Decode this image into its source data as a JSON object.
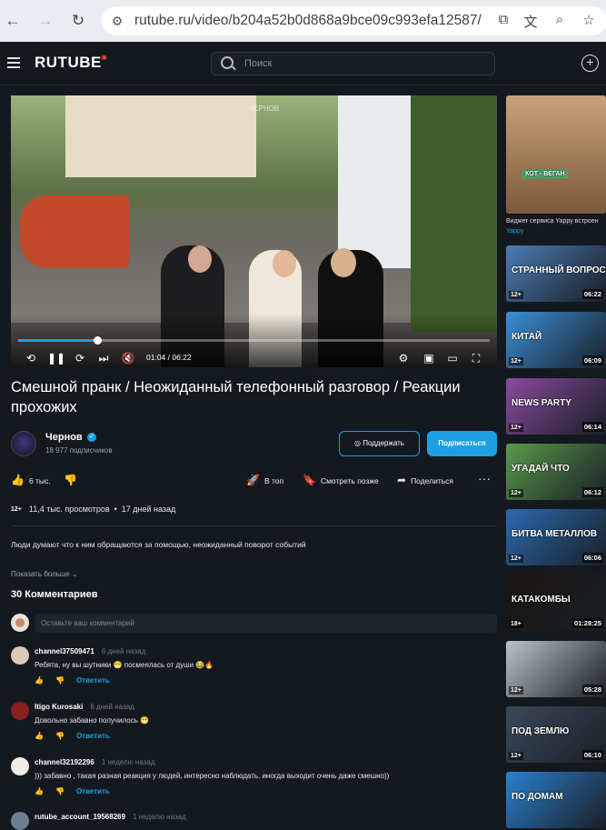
{
  "browser": {
    "url": "rutube.ru/video/b204a52b0d868a9bce09c993efa12587/"
  },
  "header": {
    "logo": "RUTUBE",
    "search_placeholder": "Поиск"
  },
  "player": {
    "watermark": "ЧЕРНОВ",
    "current_time": "01:04",
    "duration": "06:22",
    "time_label": "01:04 / 06:22",
    "progress_fraction": 0.167
  },
  "video": {
    "title": "Смешной пранк / Неожиданный телефонный разговор / Реакции прохожих",
    "channel_name": "Чернов",
    "subscribers": "18 977 подписчиков",
    "support_label": "Поддержать",
    "subscribe_label": "Подписаться",
    "likes": "6 тыс.",
    "top_label": "В топ",
    "watch_later_label": "Смотреть позже",
    "share_label": "Поделиться",
    "age_rating": "12+",
    "views": "11,4 тыс. просмотров",
    "published": "17 дней назад",
    "description": "Люди думают что к ним обращаются за помощью, неожиданный поворот событий",
    "show_more": "Показать больше"
  },
  "comments": {
    "count_label": "30 Комментариев",
    "input_placeholder": "Оставьте ваш комментарий",
    "reply_label": "Ответить",
    "items": [
      {
        "author": "channel37509471",
        "when": "6 дней назад",
        "text": "Ребята, ну вы шутники 😁 посмеялась от души 😂🔥"
      },
      {
        "author": "Itigo Kurosaki",
        "when": "6 дней назад",
        "text": "Довольно забавно получилось 😁"
      },
      {
        "author": "channel32192296",
        "when": "1 неделю назад",
        "text": "))) забавно , такая разная реакция у людей, интересно наблюдать, иногда выходит очень даже смешно))"
      },
      {
        "author": "rutube_account_19568269",
        "when": "1 неделю назад",
        "text": ""
      }
    ]
  },
  "sidebar": {
    "ad_caption": "Виджет сервиса Yappy встроен",
    "ad_source": "Yappy",
    "ad_thumb_text": "КОТ - ВЕГАН",
    "items": [
      {
        "badge": "12+",
        "duration": "06:22",
        "caption": "СТРАННЫЙ ВОПРОС",
        "color": "#4a7db5"
      },
      {
        "badge": "12+",
        "duration": "06:09",
        "caption": "КИТАЙ",
        "color": "#3a8fd8"
      },
      {
        "badge": "12+",
        "duration": "06:14",
        "caption": "NEWS PARTY",
        "color": "#8a4aa0"
      },
      {
        "badge": "12+",
        "duration": "06:12",
        "caption": "УГАДАЙ ЧТО",
        "color": "#5a9a4a"
      },
      {
        "badge": "12+",
        "duration": "06:06",
        "caption": "БИТВА МЕТАЛЛОВ",
        "color": "#2a6ab0"
      },
      {
        "badge": "18+",
        "duration": "01:28:25",
        "caption": "КАТАКОМБЫ",
        "color": "#1a1510"
      },
      {
        "badge": "12+",
        "duration": "05:28",
        "caption": "",
        "color": "#b8c4cc"
      },
      {
        "badge": "12+",
        "duration": "06:10",
        "caption": "ПОД ЗЕМЛЮ",
        "color": "#3a4a5a"
      },
      {
        "badge": "",
        "duration": "",
        "caption": "ПО ДОМАМ",
        "color": "#2a7fd0"
      }
    ]
  }
}
